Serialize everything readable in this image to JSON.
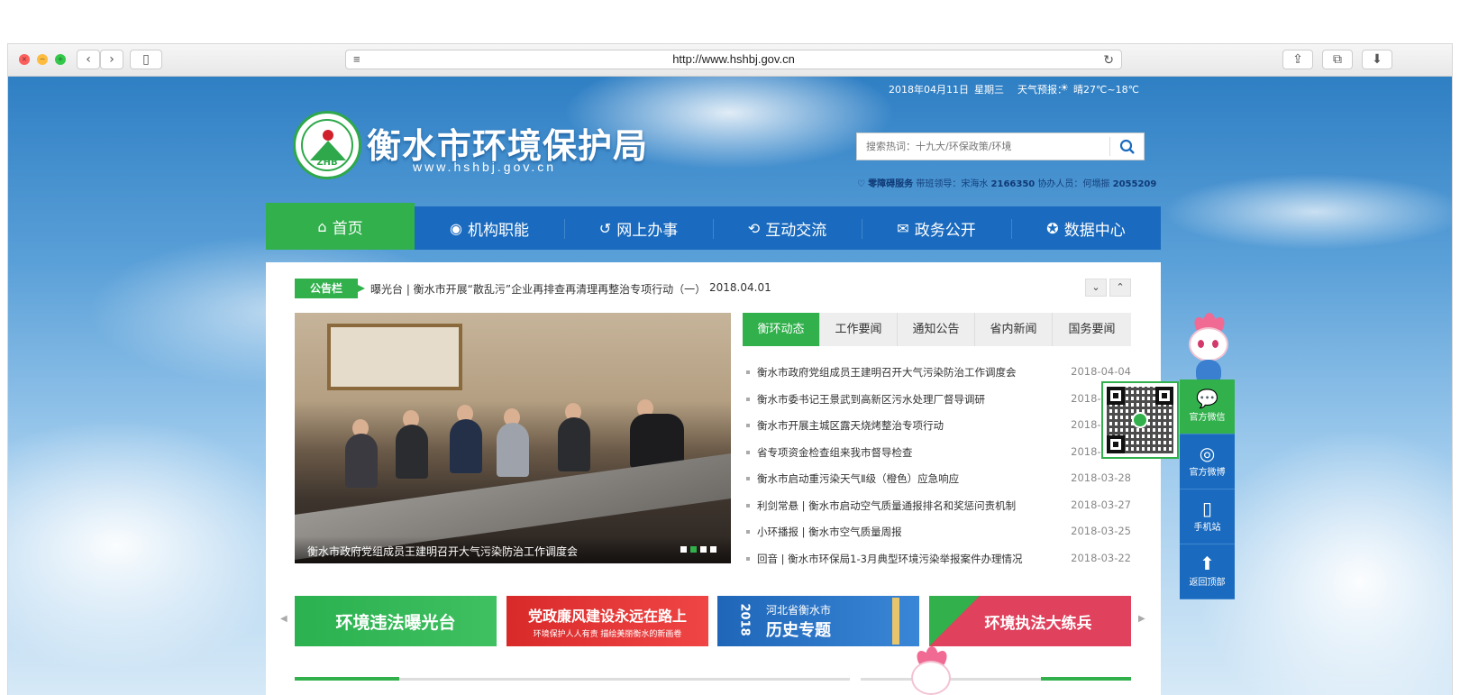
{
  "browser": {
    "url": "http://www.hshbj.gov.cn",
    "icons": [
      "close-icon",
      "minimize-icon",
      "zoom-icon",
      "back-icon",
      "forward-icon",
      "sidebar-icon",
      "reader-icon",
      "reload-icon",
      "share-icon",
      "tabs-icon",
      "download-icon"
    ]
  },
  "topbar": {
    "date": "2018年04月11日",
    "weekday": "星期三",
    "weather_label": "天气预报：",
    "weather_value": "晴27℃~18℃"
  },
  "header": {
    "logo_text": "ZHB",
    "site_title": "衡水市环境保护局",
    "site_url": "www.hshbj.gov.cn",
    "search_placeholder": "搜索热词：十九大/环保政策/环境",
    "service_label": "零障碍服务",
    "service_detail": "带班领导：宋海水",
    "service_phone1": "2166350",
    "service_assist": "协办人员：何塌振",
    "service_phone2": "2055209"
  },
  "nav": {
    "items": [
      {
        "label": "首页",
        "icon": "home-icon"
      },
      {
        "label": "机构职能",
        "icon": "location-icon"
      },
      {
        "label": "网上办事",
        "icon": "refresh-icon"
      },
      {
        "label": "互动交流",
        "icon": "sync-icon"
      },
      {
        "label": "政务公开",
        "icon": "chat-icon"
      },
      {
        "label": "数据中心",
        "icon": "compass-icon"
      }
    ]
  },
  "notice": {
    "tag": "公告栏",
    "text": "曝光台 | 衡水市开展“散乱污”企业再排查再清理再整治专项行动（一）",
    "date": "2018.04.01"
  },
  "slider": {
    "caption": "衡水市政府党组成员王建明召开大气污染防治工作调度会",
    "dots": 4,
    "active_dot": 2
  },
  "tabs": [
    {
      "label": "衡环动态"
    },
    {
      "label": "工作要闻"
    },
    {
      "label": "通知公告"
    },
    {
      "label": "省内新闻"
    },
    {
      "label": "国务要闻"
    }
  ],
  "news": [
    {
      "title": "衡水市政府党组成员王建明召开大气污染防治工作调度会",
      "date": "2018-04-04"
    },
    {
      "title": "衡水市委书记王景武到高新区污水处理厂督导调研",
      "date": "2018-04-03"
    },
    {
      "title": "衡水市开展主城区露天烧烤整治专项行动",
      "date": "2018-04-02"
    },
    {
      "title": "省专项资金检查组来我市督导检查",
      "date": "2018-04-01"
    },
    {
      "title": "衡水市启动重污染天气Ⅱ级（橙色）应急响应",
      "date": "2018-03-28"
    },
    {
      "title": "利剑常悬 | 衡水市启动空气质量通报排名和奖惩问责机制",
      "date": "2018-03-27"
    },
    {
      "title": "小环播报 | 衡水市空气质量周报",
      "date": "2018-03-25"
    },
    {
      "title": "回音 | 衡水市环保局1-3月典型环境污染举报案件办理情况",
      "date": "2018-03-22"
    }
  ],
  "banners": {
    "b1": "环境违法曝光台",
    "b2_main": "党政廉风建设永远在路上",
    "b2_sub": "环境保护人人有责 描绘美丽衡水的新画卷",
    "b3_year": "2018",
    "b3_top": "河北省衡水市",
    "b3_main": "历史专题",
    "b4": "环境执法大练兵"
  },
  "sidebar": [
    {
      "label": "官方微信",
      "icon": "wechat-icon"
    },
    {
      "label": "官方微博",
      "icon": "weibo-icon"
    },
    {
      "label": "手机站",
      "icon": "phone-icon"
    },
    {
      "label": "返回顶部",
      "icon": "arrow-up-icon"
    }
  ],
  "colors": {
    "primary_blue": "#1a6bbf",
    "primary_green": "#31b04c",
    "banner_red": "#e23a3a",
    "banner_pink": "#e0415c"
  }
}
